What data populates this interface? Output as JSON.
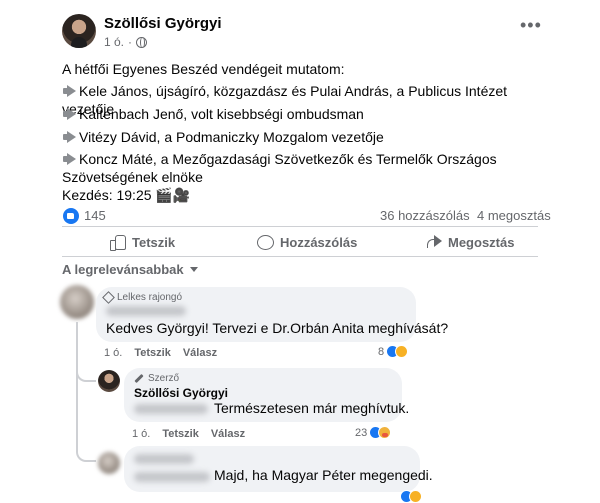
{
  "post": {
    "author": "Szöllősi Györgyi",
    "time": "1 ó.",
    "visibility_icon": "globe-icon",
    "more_icon": "•••",
    "lines": [
      "A hétfői Egyenes Beszéd vendégeit mutatom:",
      "Kele János, újságíró, közgazdász és Pulai András, a Publicus Intézet vezetője",
      "Kaltenbach Jenő, volt kisebbségi ombudsman",
      "Vitézy Dávid, a Podmaniczky Mozgalom vezetője",
      "Koncz Máté, a Mezőgazdasági Szövetkezők és Termelők Országos Szövetségének elnöke",
      "Kezdés: 19:25 🎬🎥"
    ],
    "reactions_count": "145",
    "comments_count": "36 hozzászólás",
    "shares_count": "4 megosztás"
  },
  "actions": {
    "like": "Tetszik",
    "comment": "Hozzászólás",
    "share": "Megosztás"
  },
  "sort_label": "A legrelevánsabbak",
  "comments": [
    {
      "badge": "Lelkes rajongó",
      "text": "Kedves Györgyi! Tervezi e Dr.Orbán Anita meghívását?",
      "time": "1 ó.",
      "like": "Tetszik",
      "reply": "Válasz",
      "reactions": "8"
    },
    {
      "badge": "Szerző",
      "name": "Szöllősi Györgyi",
      "text": "Természetesen már meghívtuk.",
      "time": "1 ó.",
      "like": "Tetszik",
      "reply": "Válasz",
      "reactions": "23"
    },
    {
      "text": "Majd, ha Magyar Péter megengedi."
    }
  ],
  "colors": {
    "accent": "#1877f2",
    "muted_text": "#65676b",
    "bubble": "#f0f2f5"
  }
}
